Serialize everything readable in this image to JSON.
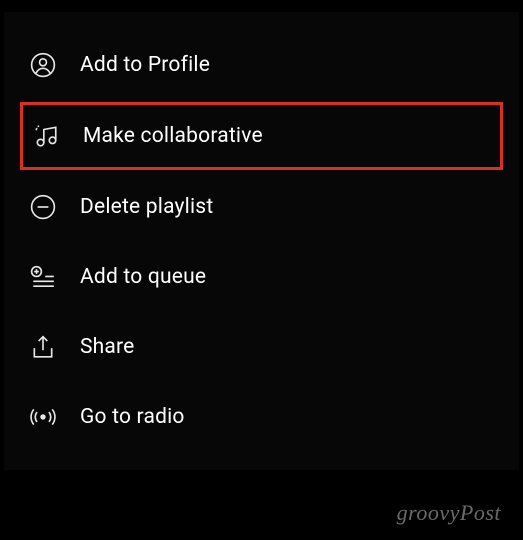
{
  "menu": {
    "items": [
      {
        "label": "Add to Profile",
        "icon": "profile-icon",
        "highlighted": false
      },
      {
        "label": "Make collaborative",
        "icon": "music-note-icon",
        "highlighted": true
      },
      {
        "label": "Delete playlist",
        "icon": "minus-circle-icon",
        "highlighted": false
      },
      {
        "label": "Add to queue",
        "icon": "add-queue-icon",
        "highlighted": false
      },
      {
        "label": "Share",
        "icon": "share-icon",
        "highlighted": false
      },
      {
        "label": "Go to radio",
        "icon": "radio-icon",
        "highlighted": false
      }
    ]
  },
  "watermark": "groovyPost"
}
